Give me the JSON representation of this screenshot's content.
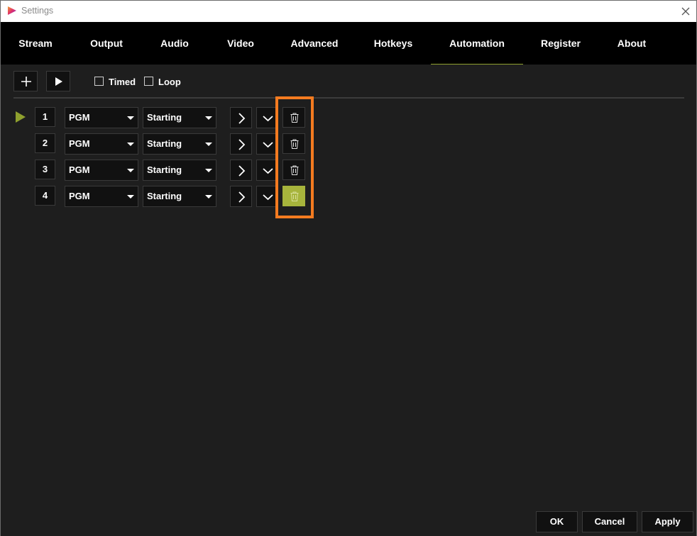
{
  "window": {
    "title": "Settings",
    "logo_icon": "app-logo-icon",
    "close_icon": "close-icon"
  },
  "tabs": [
    {
      "label": "Stream"
    },
    {
      "label": "Output"
    },
    {
      "label": "Audio"
    },
    {
      "label": "Video"
    },
    {
      "label": "Advanced"
    },
    {
      "label": "Hotkeys"
    },
    {
      "label": "Automation",
      "active": true
    },
    {
      "label": "Register"
    },
    {
      "label": "About"
    }
  ],
  "toolbar": {
    "add_icon": "plus-icon",
    "play_icon": "play-icon",
    "timed_label": "Timed",
    "timed_checked": false,
    "loop_label": "Loop",
    "loop_checked": false
  },
  "rows": [
    {
      "number": "1",
      "source": "PGM",
      "event": "Starting",
      "active": true
    },
    {
      "number": "2",
      "source": "PGM",
      "event": "Starting",
      "active": false
    },
    {
      "number": "3",
      "source": "PGM",
      "event": "Starting",
      "active": false
    },
    {
      "number": "4",
      "source": "PGM",
      "event": "Starting",
      "active": false,
      "delete_hovered": true
    }
  ],
  "row_icons": {
    "next": "chevron-right-icon",
    "expand": "chevron-down-icon",
    "delete": "trash-icon"
  },
  "footer": {
    "ok_label": "OK",
    "cancel_label": "Cancel",
    "apply_label": "Apply"
  },
  "colors": {
    "accent": "#8fa02e",
    "hover_delete": "#a7b43c",
    "highlight": "#f47b20",
    "tabbar_bg": "#000000",
    "content_bg": "#1e1e1e"
  }
}
